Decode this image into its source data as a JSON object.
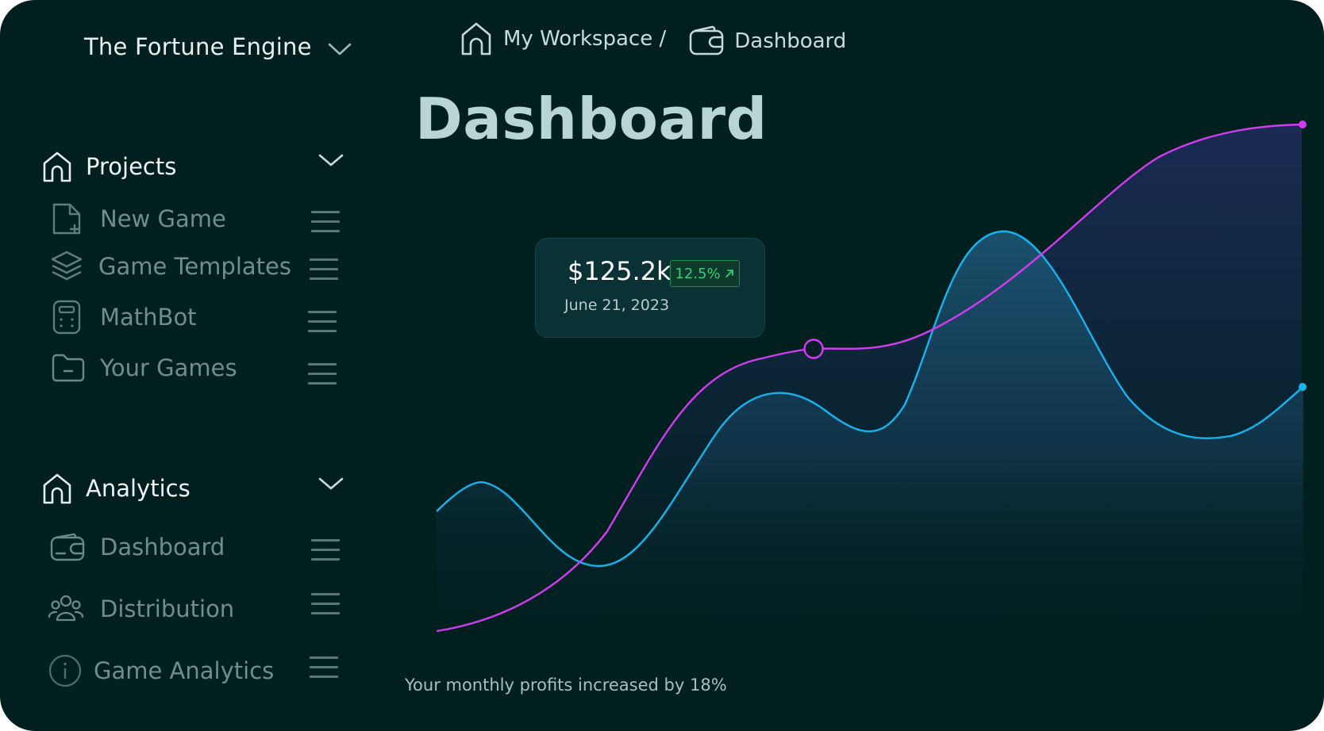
{
  "app": {
    "name": "The Fortune Engine",
    "switcher_icon": "chevron-down-icon"
  },
  "breadcrumb": {
    "workspace": "My Workspace /",
    "workspace_icon": "home-icon",
    "current": "Dashboard",
    "current_icon": "wallet-icon"
  },
  "page": {
    "title": "Dashboard",
    "footnote": "Your monthly profits increased by 18%"
  },
  "sidebar": {
    "projects": {
      "label": "Projects",
      "icon": "home-icon",
      "items": [
        {
          "label": "New Game",
          "icon": "new-file-icon"
        },
        {
          "label": "Game Templates",
          "icon": "layers-icon"
        },
        {
          "label": "MathBot",
          "icon": "calculator-icon"
        },
        {
          "label": "Your Games",
          "icon": "folder-icon"
        }
      ]
    },
    "analytics": {
      "label": "Analytics",
      "icon": "home-icon",
      "items": [
        {
          "label": "Dashboard",
          "icon": "wallet-icon"
        },
        {
          "label": "Distribution",
          "icon": "users-icon"
        },
        {
          "label": "Game Analytics",
          "icon": "info-icon"
        }
      ]
    }
  },
  "tooltip": {
    "value": "$125.2k",
    "change": "12.5%",
    "change_icon": "arrow-up-right-icon",
    "date": "June 21, 2023"
  },
  "colors": {
    "background": "#021f20",
    "series_purple": "#d13cf0",
    "series_blue": "#16b4ee",
    "badge_green": "#2fd07d"
  }
}
